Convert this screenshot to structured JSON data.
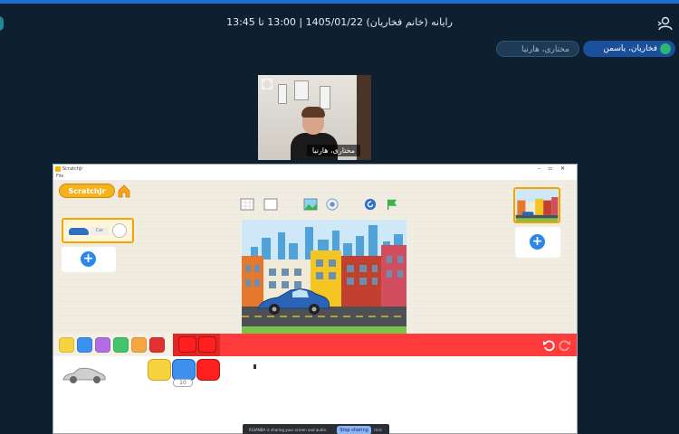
{
  "session": {
    "title": "رایانه (خانم فخاریان) 1405/01/22 | 13:00 تا 13:45"
  },
  "participants": {
    "primary_chip": "فخاریان، یاسمن",
    "secondary_chip": "مختاری، هارنیا"
  },
  "camera": {
    "name_label": "مختاری، هارنیا"
  },
  "shared_window": {
    "app_title": "ScratchJr",
    "menu_label": "File",
    "logo_text": "ScratchJr",
    "sprite_label": "Car",
    "block_count": "10"
  },
  "share_banner": {
    "message": "RGIANBA is sharing your screen and audio.",
    "stop_label": "Stop sharing",
    "hide_label": "Hide"
  },
  "colors": {
    "accent": "#1e6fd0",
    "background": "#0e1f30",
    "palette_red": "#ff3b3b",
    "scratch_orange": "#f6b21b"
  },
  "icons": {
    "user": "user-icon",
    "expand": "expand-icon",
    "home": "home-icon",
    "flag": "green-flag-icon",
    "undo": "undo-icon",
    "redo": "redo-icon"
  },
  "palette_categories": [
    "triggers",
    "motion",
    "looks",
    "sound",
    "control",
    "end"
  ]
}
